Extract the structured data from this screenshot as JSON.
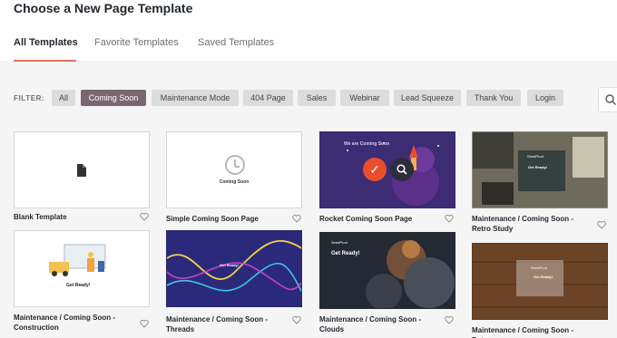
{
  "page": {
    "title": "Choose a New Page Template"
  },
  "tabs": [
    {
      "label": "All Templates",
      "active": true
    },
    {
      "label": "Favorite Templates",
      "active": false
    },
    {
      "label": "Saved Templates",
      "active": false
    }
  ],
  "filter": {
    "label": "FILTER:",
    "chips": [
      {
        "label": "All",
        "active": false
      },
      {
        "label": "Coming Soon",
        "active": true
      },
      {
        "label": "Maintenance Mode",
        "active": false
      },
      {
        "label": "404 Page",
        "active": false
      },
      {
        "label": "Sales",
        "active": false
      },
      {
        "label": "Webinar",
        "active": false
      },
      {
        "label": "Lead Squeeze",
        "active": false
      },
      {
        "label": "Thank You",
        "active": false
      },
      {
        "label": "Login",
        "active": false
      }
    ]
  },
  "templates": [
    {
      "name": "Blank Template"
    },
    {
      "name": "Simple Coming Soon Page",
      "preview_heading": "Coming Soon"
    },
    {
      "name": "Rocket Coming Soon Page",
      "preview_heading": "We are Coming Soon"
    },
    {
      "name": "Maintenance / Coming Soon - Retro Study",
      "preview_brand": "SeedProd",
      "preview_heading": "Get Ready!"
    },
    {
      "name": "Maintenance / Coming Soon - Construction",
      "preview_heading": "Get Ready!"
    },
    {
      "name": "Maintenance / Coming Soon - Threads",
      "preview_heading": "Get Ready!"
    },
    {
      "name": "Maintenance / Coming Soon - Clouds",
      "preview_brand": "SeedProd",
      "preview_heading": "Get Ready!"
    },
    {
      "name": "Maintenance / Coming Soon - Retro",
      "preview_brand": "SeedProd",
      "preview_heading": "Get Ready!"
    }
  ],
  "colors": {
    "accent": "#e86f5a",
    "active_chip": "#7a6670"
  }
}
